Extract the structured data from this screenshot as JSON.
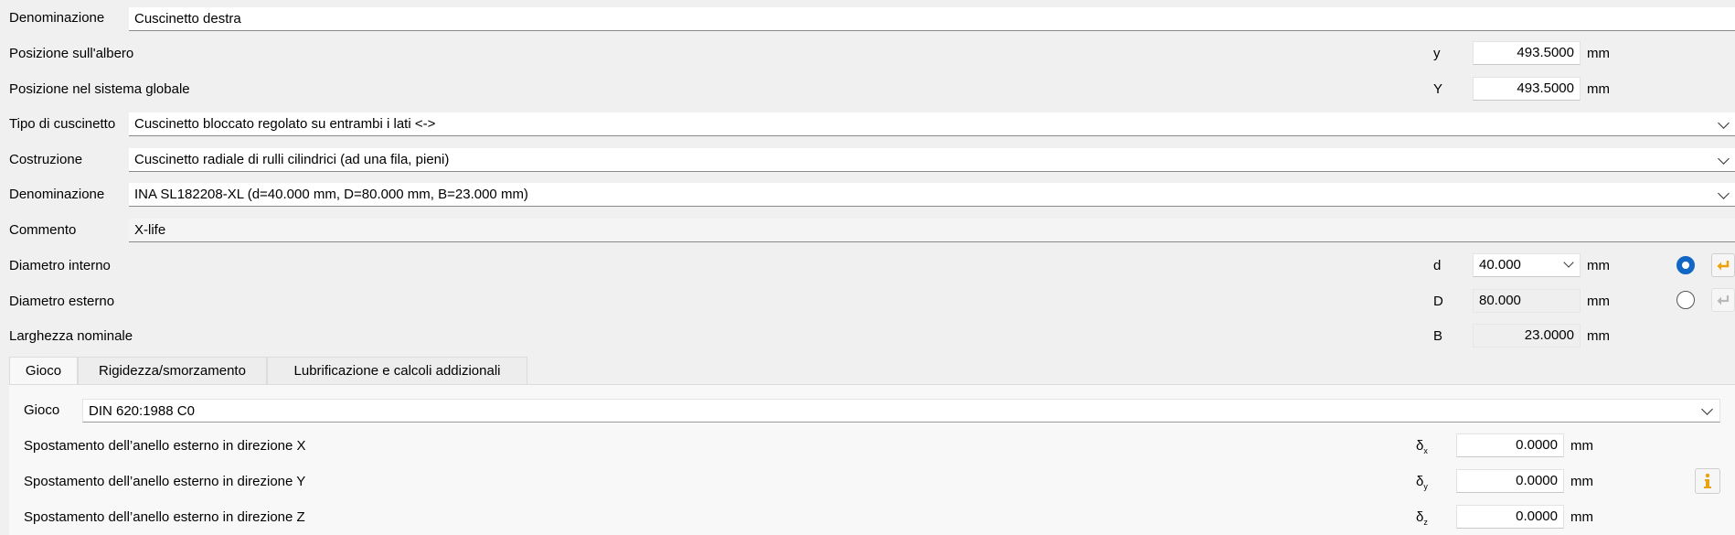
{
  "rows": {
    "denominazione_top": {
      "label": "Denominazione",
      "value": "Cuscinetto destra"
    },
    "pos_albero": {
      "label": "Posizione sull'albero",
      "symbol": "y",
      "value": "493.5000",
      "unit": "mm"
    },
    "pos_globale": {
      "label": "Posizione nel sistema globale",
      "symbol": "Y",
      "value": "493.5000",
      "unit": "mm"
    },
    "tipo": {
      "label": "Tipo di cuscinetto",
      "value": "Cuscinetto bloccato regolato su entrambi i lati <->"
    },
    "costruzione": {
      "label": "Costruzione",
      "value": "Cuscinetto radiale di rulli cilindrici (ad una fila, pieni)"
    },
    "denominazione": {
      "label": "Denominazione",
      "value": "INA SL182208-XL (d=40.000 mm, D=80.000 mm, B=23.000 mm)"
    },
    "commento": {
      "label": "Commento",
      "value": "X-life"
    },
    "diam_int": {
      "label": "Diametro interno",
      "symbol": "d",
      "value": "40.000",
      "unit": "mm",
      "radio_selected": true
    },
    "diam_est": {
      "label": "Diametro esterno",
      "symbol": "D",
      "value": "80.000",
      "unit": "mm",
      "radio_selected": false
    },
    "larghezza": {
      "label": "Larghezza nominale",
      "symbol": "B",
      "value": "23.0000",
      "unit": "mm"
    }
  },
  "tabs": [
    {
      "label": "Gioco",
      "active": true
    },
    {
      "label": "Rigidezza/smorzamento",
      "active": false
    },
    {
      "label": "Lubrificazione e calcoli addizionali",
      "active": false
    }
  ],
  "gioco": {
    "gioco": {
      "label": "Gioco",
      "value": "DIN 620:1988 C0"
    },
    "spost_x": {
      "label": "Spostamento dell’anello esterno in direzione X",
      "symbol": "δ",
      "sub": "x",
      "value": "0.0000",
      "unit": "mm"
    },
    "spost_y": {
      "label": "Spostamento dell’anello esterno in direzione Y",
      "symbol": "δ",
      "sub": "y",
      "value": "0.0000",
      "unit": "mm"
    },
    "spost_z": {
      "label": "Spostamento dell’anello esterno in direzione Z",
      "symbol": "δ",
      "sub": "z",
      "value": "0.0000",
      "unit": "mm"
    }
  },
  "icons": {
    "apply_active": "arrow-return-icon",
    "apply_inactive": "arrow-return-icon",
    "info": "info-icon",
    "dropdown": "chevron-down-icon"
  },
  "colors": {
    "accent": "#1266c4",
    "return_arrow": "#f0a000",
    "info": "#e8a317"
  }
}
